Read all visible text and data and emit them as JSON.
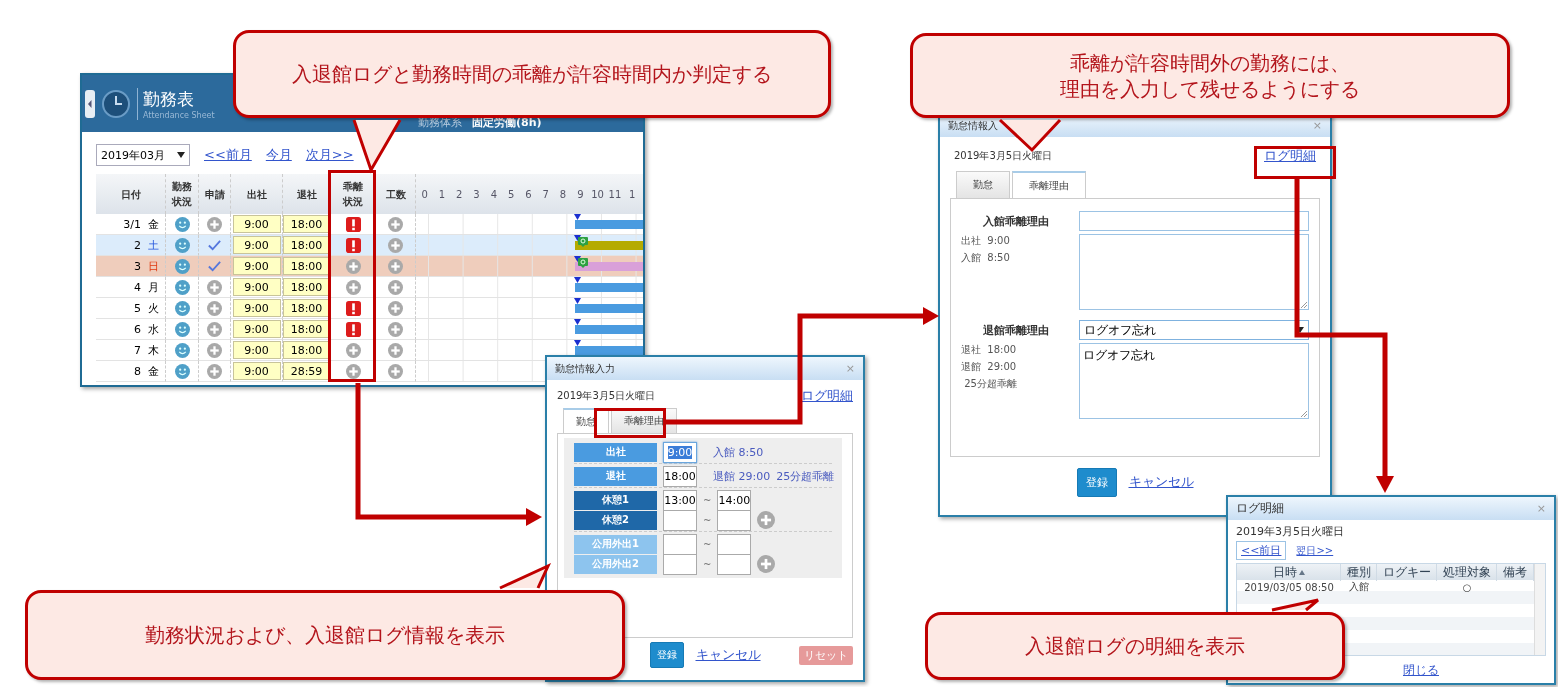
{
  "attendance_sheet": {
    "title": "勤務表",
    "subtitle": "Attendance Sheet",
    "work_system_label": "勤務体系",
    "work_system_value": "固定労働(8h)",
    "month": "2019年03月",
    "nav_links": [
      "<<前月",
      "今月",
      "次月>>"
    ],
    "columns": [
      "日付",
      "勤務状況",
      "申請",
      "出社",
      "退社",
      "乖離状況",
      "工数"
    ],
    "hours": [
      "0",
      "1",
      "2",
      "3",
      "4",
      "5",
      "6",
      "7",
      "8",
      "9",
      "10",
      "11",
      "1"
    ],
    "rows": [
      {
        "date": "3/1",
        "weekday": "金",
        "kind": "weekday",
        "approved": false,
        "clock_in": "9:00",
        "clock_out": "18:00",
        "deviation_alert": true,
        "color": "#4a9be0",
        "flag": false
      },
      {
        "date": "2",
        "weekday": "土",
        "kind": "saturday",
        "approved": true,
        "clock_in": "9:00",
        "clock_out": "18:00",
        "deviation_alert": true,
        "color": "#b5ab00",
        "flag": true
      },
      {
        "date": "3",
        "weekday": "日",
        "kind": "sunday",
        "approved": true,
        "clock_in": "9:00",
        "clock_out": "18:00",
        "deviation_alert": false,
        "color": "#d9a0d9",
        "flag": true
      },
      {
        "date": "4",
        "weekday": "月",
        "kind": "weekday",
        "approved": false,
        "clock_in": "9:00",
        "clock_out": "18:00",
        "deviation_alert": false,
        "color": "#4a9be0",
        "flag": false
      },
      {
        "date": "5",
        "weekday": "火",
        "kind": "weekday",
        "approved": false,
        "clock_in": "9:00",
        "clock_out": "18:00",
        "deviation_alert": true,
        "color": "#4a9be0",
        "flag": false
      },
      {
        "date": "6",
        "weekday": "水",
        "kind": "weekday",
        "approved": false,
        "clock_in": "9:00",
        "clock_out": "18:00",
        "deviation_alert": true,
        "color": "#4a9be0",
        "flag": false
      },
      {
        "date": "7",
        "weekday": "木",
        "kind": "weekday",
        "approved": false,
        "clock_in": "9:00",
        "clock_out": "18:00",
        "deviation_alert": false,
        "color": "#4a9be0",
        "flag": false
      },
      {
        "date": "8",
        "weekday": "金",
        "kind": "weekday",
        "approved": false,
        "clock_in": "9:00",
        "clock_out": "28:59",
        "deviation_alert": false
      }
    ]
  },
  "entry_dialog": {
    "title": "勤怠情報入力",
    "close": "×",
    "date": "2019年3月5日火曜日",
    "log_link": "ログ明細",
    "tabs": [
      {
        "label": "勤怠",
        "selected": true
      },
      {
        "label": "乖離理由",
        "selected": false
      }
    ],
    "rows": [
      {
        "label": "出社",
        "kind": "primary",
        "start": "9:00",
        "focused": true,
        "notes": [
          "入館 8:50"
        ]
      },
      {
        "label": "退社",
        "kind": "primary",
        "start": "18:00",
        "focused": false,
        "notes": [
          "退館 29:00",
          "25分超乖離"
        ]
      },
      {
        "label": "休憩1",
        "kind": "dark",
        "start": "13:00",
        "separator": "~",
        "end": "14:00",
        "focused": false,
        "add": false
      },
      {
        "label": "休憩2",
        "kind": "dark",
        "separator": "~",
        "focused": false,
        "add": true
      },
      {
        "label": "公用外出1",
        "kind": "light",
        "separator": "~",
        "focused": false,
        "add": false
      },
      {
        "label": "公用外出2",
        "kind": "light",
        "separator": "~",
        "focused": false,
        "add": true
      }
    ],
    "buttons": {
      "register": "登録",
      "cancel": "キャンセル",
      "reset": "リセット"
    }
  },
  "reason_dialog": {
    "title": "勤怠情報入",
    "close": "×",
    "date": "2019年3月5日火曜日",
    "log_link": "ログ明細",
    "tabs": [
      {
        "label": "勤怠",
        "selected": false
      },
      {
        "label": "乖離理由",
        "selected": true
      }
    ],
    "sections": [
      {
        "label": "入館乖離理由",
        "info": [
          "出社  9:00",
          "入館  8:50"
        ],
        "kind": "input"
      },
      {
        "label": "退館乖離理由",
        "info": [
          "退社  18:00",
          "退館  29:00",
          " 25分超乖離"
        ],
        "kind": "select",
        "choice": "ログオフ忘れ",
        "memo": "ログオフ忘れ"
      }
    ],
    "buttons": {
      "register": "登録",
      "cancel": "キャンセル"
    }
  },
  "log_dialog": {
    "title": "ログ明細",
    "close": "×",
    "date": "2019年3月5日火曜日",
    "prev": "<<前日",
    "next": "翌日>>",
    "columns": [
      "日時",
      "種別",
      "ログキー",
      "処理対象",
      "備考"
    ],
    "rows": [
      {
        "datetime": "2019/03/05 08:50",
        "type": "入館",
        "target": "○"
      }
    ],
    "close_link": "閉じる"
  },
  "callouts": [
    {
      "lines": [
        "入退館ログと勤務時間の乖離が許容時間内か判定する"
      ]
    },
    {
      "lines": [
        "乖離が許容時間外の勤務には、",
        "理由を入力して残せるようにする"
      ]
    },
    {
      "lines": [
        "勤務状況および、入退館ログ情報を表示"
      ]
    },
    {
      "lines": [
        "入退館ログの明細を表示"
      ]
    }
  ]
}
